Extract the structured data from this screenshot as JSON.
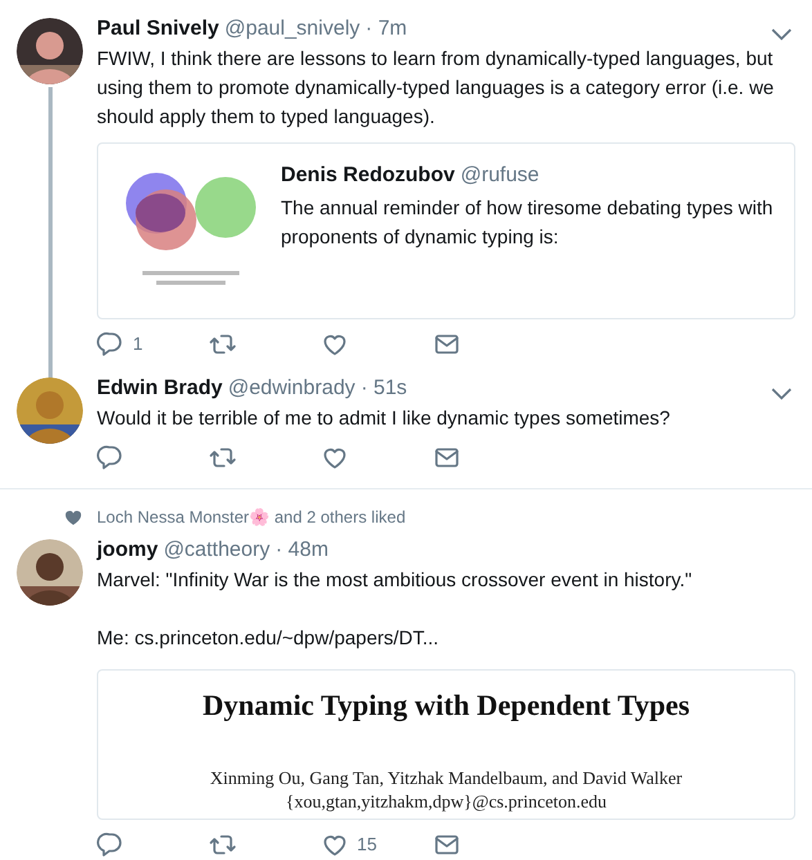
{
  "tweets": [
    {
      "name": "Paul Snively",
      "handle": "@paul_snively",
      "time": "· 7m",
      "has_menu": true,
      "thread_continues": true,
      "divider_after": false,
      "paragraphs": [
        "FWIW, I think there are lessons to learn from dynamically-typed languages, but using them to promote dynamically-typed languages is a category error (i.e. we should apply them to typed languages)."
      ],
      "quote": {
        "name": "Denis Redozubov",
        "handle": "@rufuse",
        "text": "The annual reminder of how tiresome debating types with proponents of dynamic typing is:"
      },
      "reply_count": "1"
    },
    {
      "name": "Edwin Brady",
      "handle": "@edwinbrady",
      "time": "· 51s",
      "has_menu": true,
      "thread_continues": false,
      "paragraphs": [
        "Would it be terrible of me to admit I like dynamic types sometimes?"
      ],
      "divider_after": true
    },
    {
      "social_context": "Loch Nessa Monster🌸 and 2 others liked",
      "name": "joomy",
      "handle": "@cattheory",
      "time": "· 48m",
      "has_menu": false,
      "thread_continues": false,
      "divider_after": false,
      "paragraphs": [
        "Marvel: \"Infinity War is the most ambitious crossover event in history.\"",
        "Me: cs.princeton.edu/~dpw/papers/DT..."
      ],
      "card": {
        "kind": "paper",
        "title": "Dynamic Typing with Dependent Types",
        "authors": "Xinming Ou, Gang Tan, Yitzhak Mandelbaum, and David Walker",
        "emails": "{xou,gtan,yitzhakm,dpw}@cs.princeton.edu"
      },
      "like_count": "15"
    }
  ]
}
